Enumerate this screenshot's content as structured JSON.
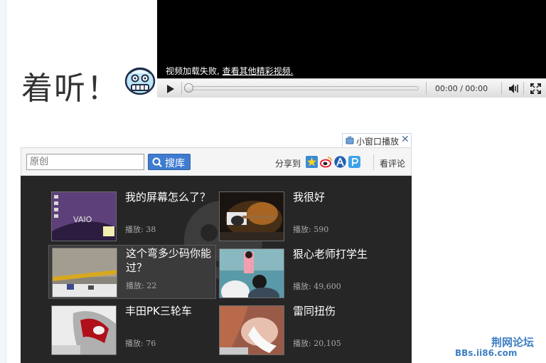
{
  "page": {
    "heading": "着听！"
  },
  "player": {
    "message_prefix": "视频加载失败,",
    "message_link": "查看其他精彩视频.",
    "time_current": "00:00",
    "time_separator": "/",
    "time_total": "00:00",
    "progress_fraction": 0
  },
  "mini_player": {
    "label": "小窗口播放",
    "close_glyph": "✕"
  },
  "search": {
    "placeholder": "原创",
    "button_label": "搜库"
  },
  "share": {
    "label": "分享到",
    "icons": [
      "qzone-icon",
      "weibo-icon",
      "renren-icon",
      "kaixin-icon"
    ]
  },
  "comments": {
    "label": "看评论"
  },
  "videos": [
    {
      "title": "我的屏幕怎么了？",
      "plays": "播放: 38"
    },
    {
      "title": "我很好",
      "plays": "播放: 590"
    },
    {
      "title": "这个弯多少码你能过？",
      "plays": "播放: 22"
    },
    {
      "title": "狠心老师打学生",
      "plays": "播放: 49,600"
    },
    {
      "title": "丰田PK三轮车",
      "plays": "播放: 76"
    },
    {
      "title": "雷同扭伤",
      "plays": "播放: 20,105"
    }
  ],
  "thumbnail_brand": "VAIO",
  "forum": {
    "name": "荆网论坛",
    "url": "BBs.ii86.com"
  },
  "colors": {
    "player_background": "#000000",
    "panel_background": "#262626",
    "search_button": "#3f7ccf",
    "forum_brand": "#3d7fc3"
  }
}
